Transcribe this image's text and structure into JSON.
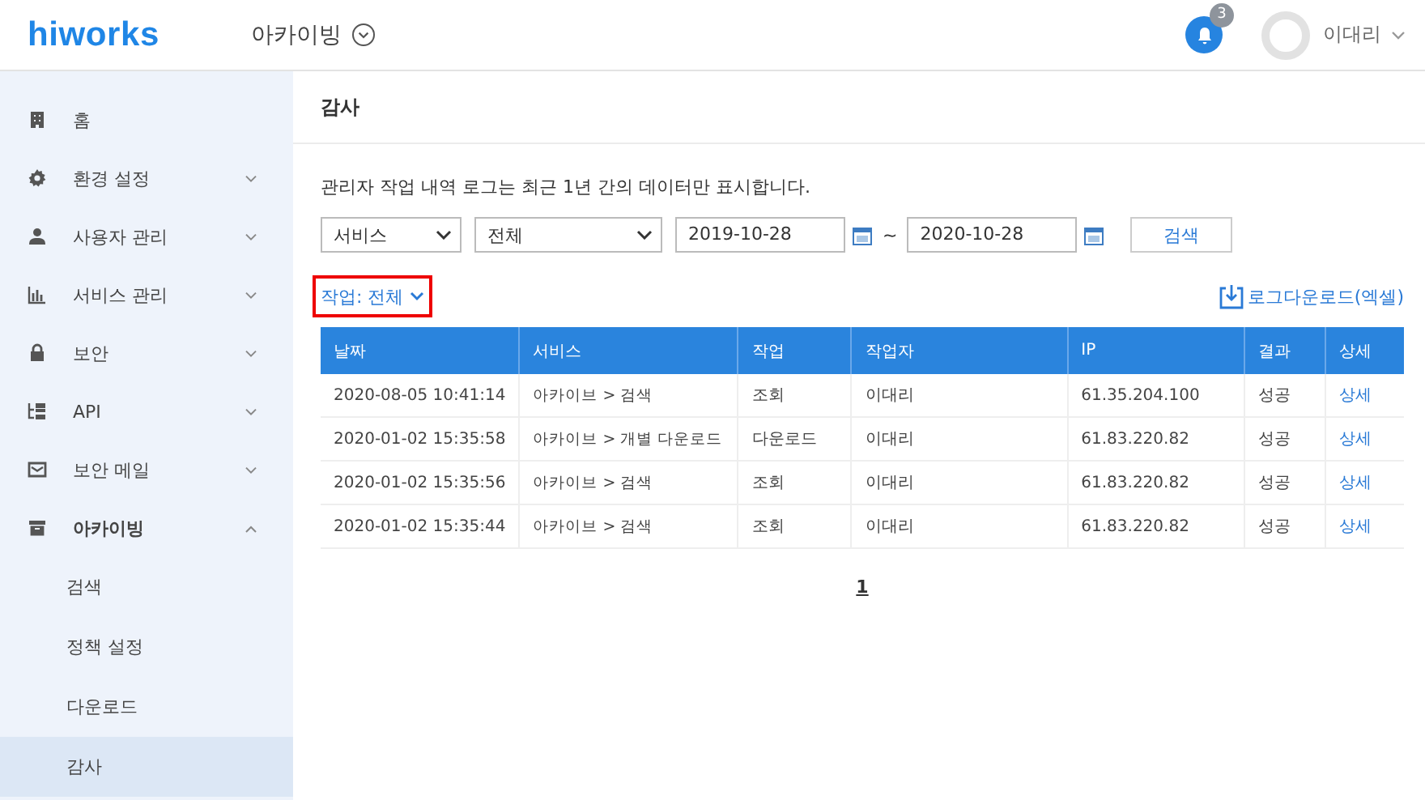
{
  "header": {
    "logo": "hiworks",
    "app_menu": "아카이빙",
    "notification_count": "3",
    "user_name": "이대리"
  },
  "sidebar": {
    "items": [
      {
        "label": "홈"
      },
      {
        "label": "환경 설정",
        "expanded": false
      },
      {
        "label": "사용자 관리",
        "expanded": false
      },
      {
        "label": "서비스 관리",
        "expanded": false
      },
      {
        "label": "보안",
        "expanded": false
      },
      {
        "label": "API",
        "expanded": false
      },
      {
        "label": "보안 메일",
        "expanded": false
      },
      {
        "label": "아카이빙",
        "expanded": true,
        "children": [
          {
            "label": "검색",
            "selected": false
          },
          {
            "label": "정책 설정",
            "selected": false
          },
          {
            "label": "다운로드",
            "selected": false
          },
          {
            "label": "감사",
            "selected": true
          }
        ]
      }
    ]
  },
  "page_title": "감사",
  "notice": "관리자 작업 내역 로그는 최근 1년 간의 데이터만 표시합니다.",
  "filters": {
    "category": "서비스",
    "scope": "전체",
    "start_date": "2019-10-28",
    "range_separator": "~",
    "end_date": "2020-10-28",
    "search_button": "검색"
  },
  "action_filter": "작업: 전체",
  "download_link": "로그다운로드(엑셀)",
  "table": {
    "columns": [
      "날짜",
      "서비스",
      "작업",
      "작업자",
      "IP",
      "결과",
      "상세"
    ],
    "rows": [
      [
        "2020-08-05 10:41:14",
        "아카이브 > 검색",
        "조회",
        "이대리",
        "61.35.204.100",
        "성공",
        "상세"
      ],
      [
        "2020-01-02 15:35:58",
        "아카이브 > 개별 다운로드",
        "다운로드",
        "이대리",
        "61.83.220.82",
        "성공",
        "상세"
      ],
      [
        "2020-01-02 15:35:56",
        "아카이브 > 검색",
        "조회",
        "이대리",
        "61.83.220.82",
        "성공",
        "상세"
      ],
      [
        "2020-01-02 15:35:44",
        "아카이브 > 검색",
        "조회",
        "이대리",
        "61.83.220.82",
        "성공",
        "상세"
      ]
    ]
  },
  "pagination": [
    {
      "label": "1",
      "selected": true
    }
  ]
}
